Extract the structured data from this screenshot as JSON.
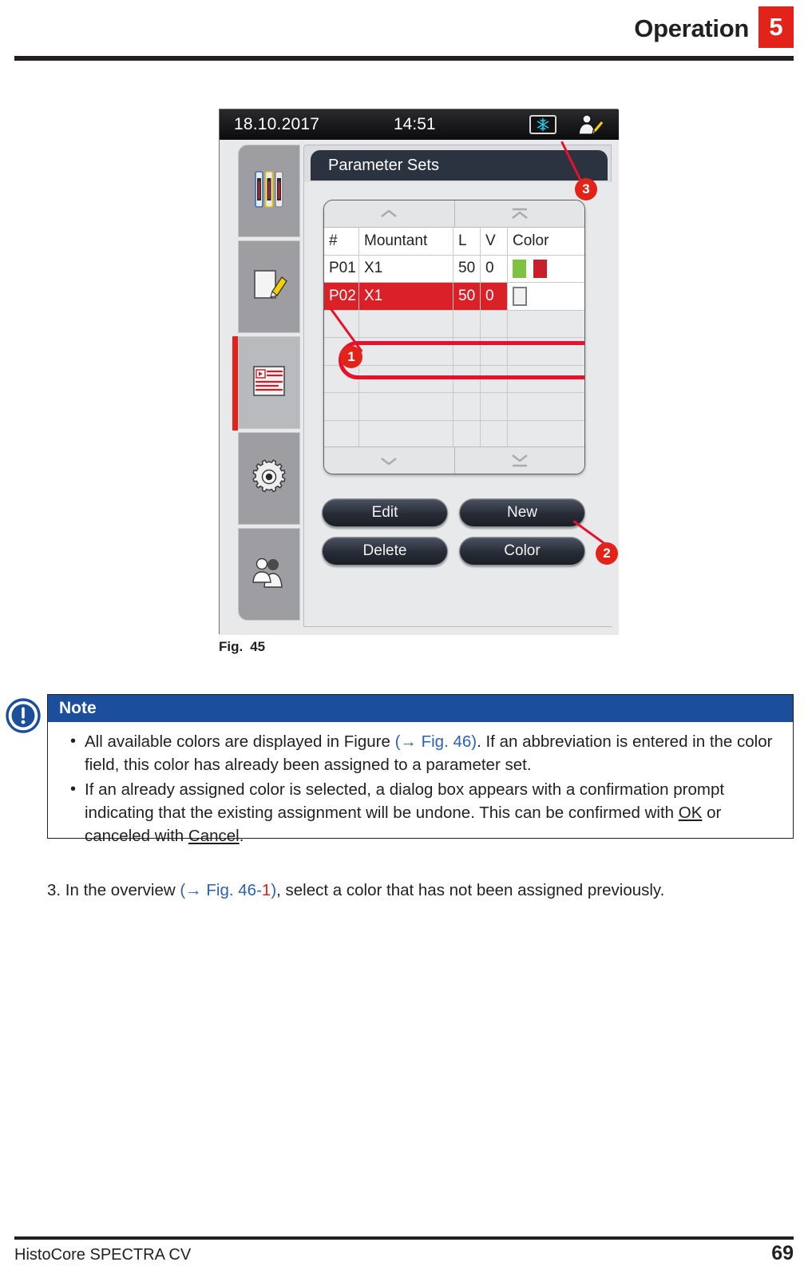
{
  "header": {
    "title": "Operation",
    "chapter": "5"
  },
  "figure": {
    "caption_label": "Fig.",
    "caption_number": "45",
    "statusbar": {
      "date": "18.10.2017",
      "time": "14:51",
      "cooling_icon": "snowflake-icon",
      "user_icon": "supervisor-user-icon"
    },
    "sidebar": {
      "items": [
        {
          "name": "reagent-bottles",
          "icon": "bottles-icon",
          "active": false
        },
        {
          "name": "programs",
          "icon": "note-pencil-icon",
          "active": false
        },
        {
          "name": "parameter-sets",
          "icon": "parameter-list-icon",
          "active": true
        },
        {
          "name": "settings",
          "icon": "gear-icon",
          "active": false
        },
        {
          "name": "user-settings",
          "icon": "users-icon",
          "active": false
        }
      ]
    },
    "panel": {
      "title": "Parameter Sets",
      "scroll": {
        "up": "chevron-up-icon",
        "top": "chevron-up-bar-icon",
        "down": "chevron-down-icon",
        "bottom": "chevron-down-bar-icon"
      },
      "table": {
        "columns": [
          "#",
          "Mountant",
          "L",
          "V",
          "Color"
        ],
        "rows": [
          {
            "num": "P01",
            "mountant": "X1",
            "l": "50",
            "v": "0",
            "colors": [
              "#7dc242",
              "#c8202b"
            ],
            "selected": false
          },
          {
            "num": "P02",
            "mountant": "X1",
            "l": "50",
            "v": "0",
            "colors": [],
            "selected": true
          }
        ],
        "empty_rows": 6
      },
      "buttons": [
        {
          "label": "Edit"
        },
        {
          "label": "New"
        },
        {
          "label": "Delete"
        },
        {
          "label": "Color"
        }
      ]
    },
    "callouts": [
      {
        "number": "1"
      },
      {
        "number": "2"
      },
      {
        "number": "3"
      }
    ]
  },
  "note": {
    "heading": "Note",
    "icon": "information-exclamation-icon",
    "items": [
      {
        "pre": "All available colors are displayed in Figure ",
        "link": "(→ Fig.  46)",
        "post": ". If an abbreviation is entered in the color field, this color has already been assigned to a parameter set."
      },
      {
        "pre": "If an already assigned color is selected, a dialog box appears with a confirmation prompt indicating that the existing assignment will be undone. This can be confirmed with ",
        "ok": "OK",
        "mid": " or canceled with ",
        "cancel": "Cancel",
        "post": "."
      }
    ]
  },
  "step": {
    "number": "3.",
    "pre": " In the overview ",
    "link_open": "(→ Fig.  46-",
    "link_ref": "1",
    "link_close": ")",
    "post": ", select a color that has not been assigned previously."
  },
  "footer": {
    "left": "HistoCore SPECTRA CV",
    "page": "69"
  },
  "colors": {
    "brand_red": "#e2231a",
    "note_blue": "#1b4f9c",
    "link_blue": "#2e62b0",
    "panel_dark": "#2b3240",
    "row_selected": "#da2128"
  }
}
